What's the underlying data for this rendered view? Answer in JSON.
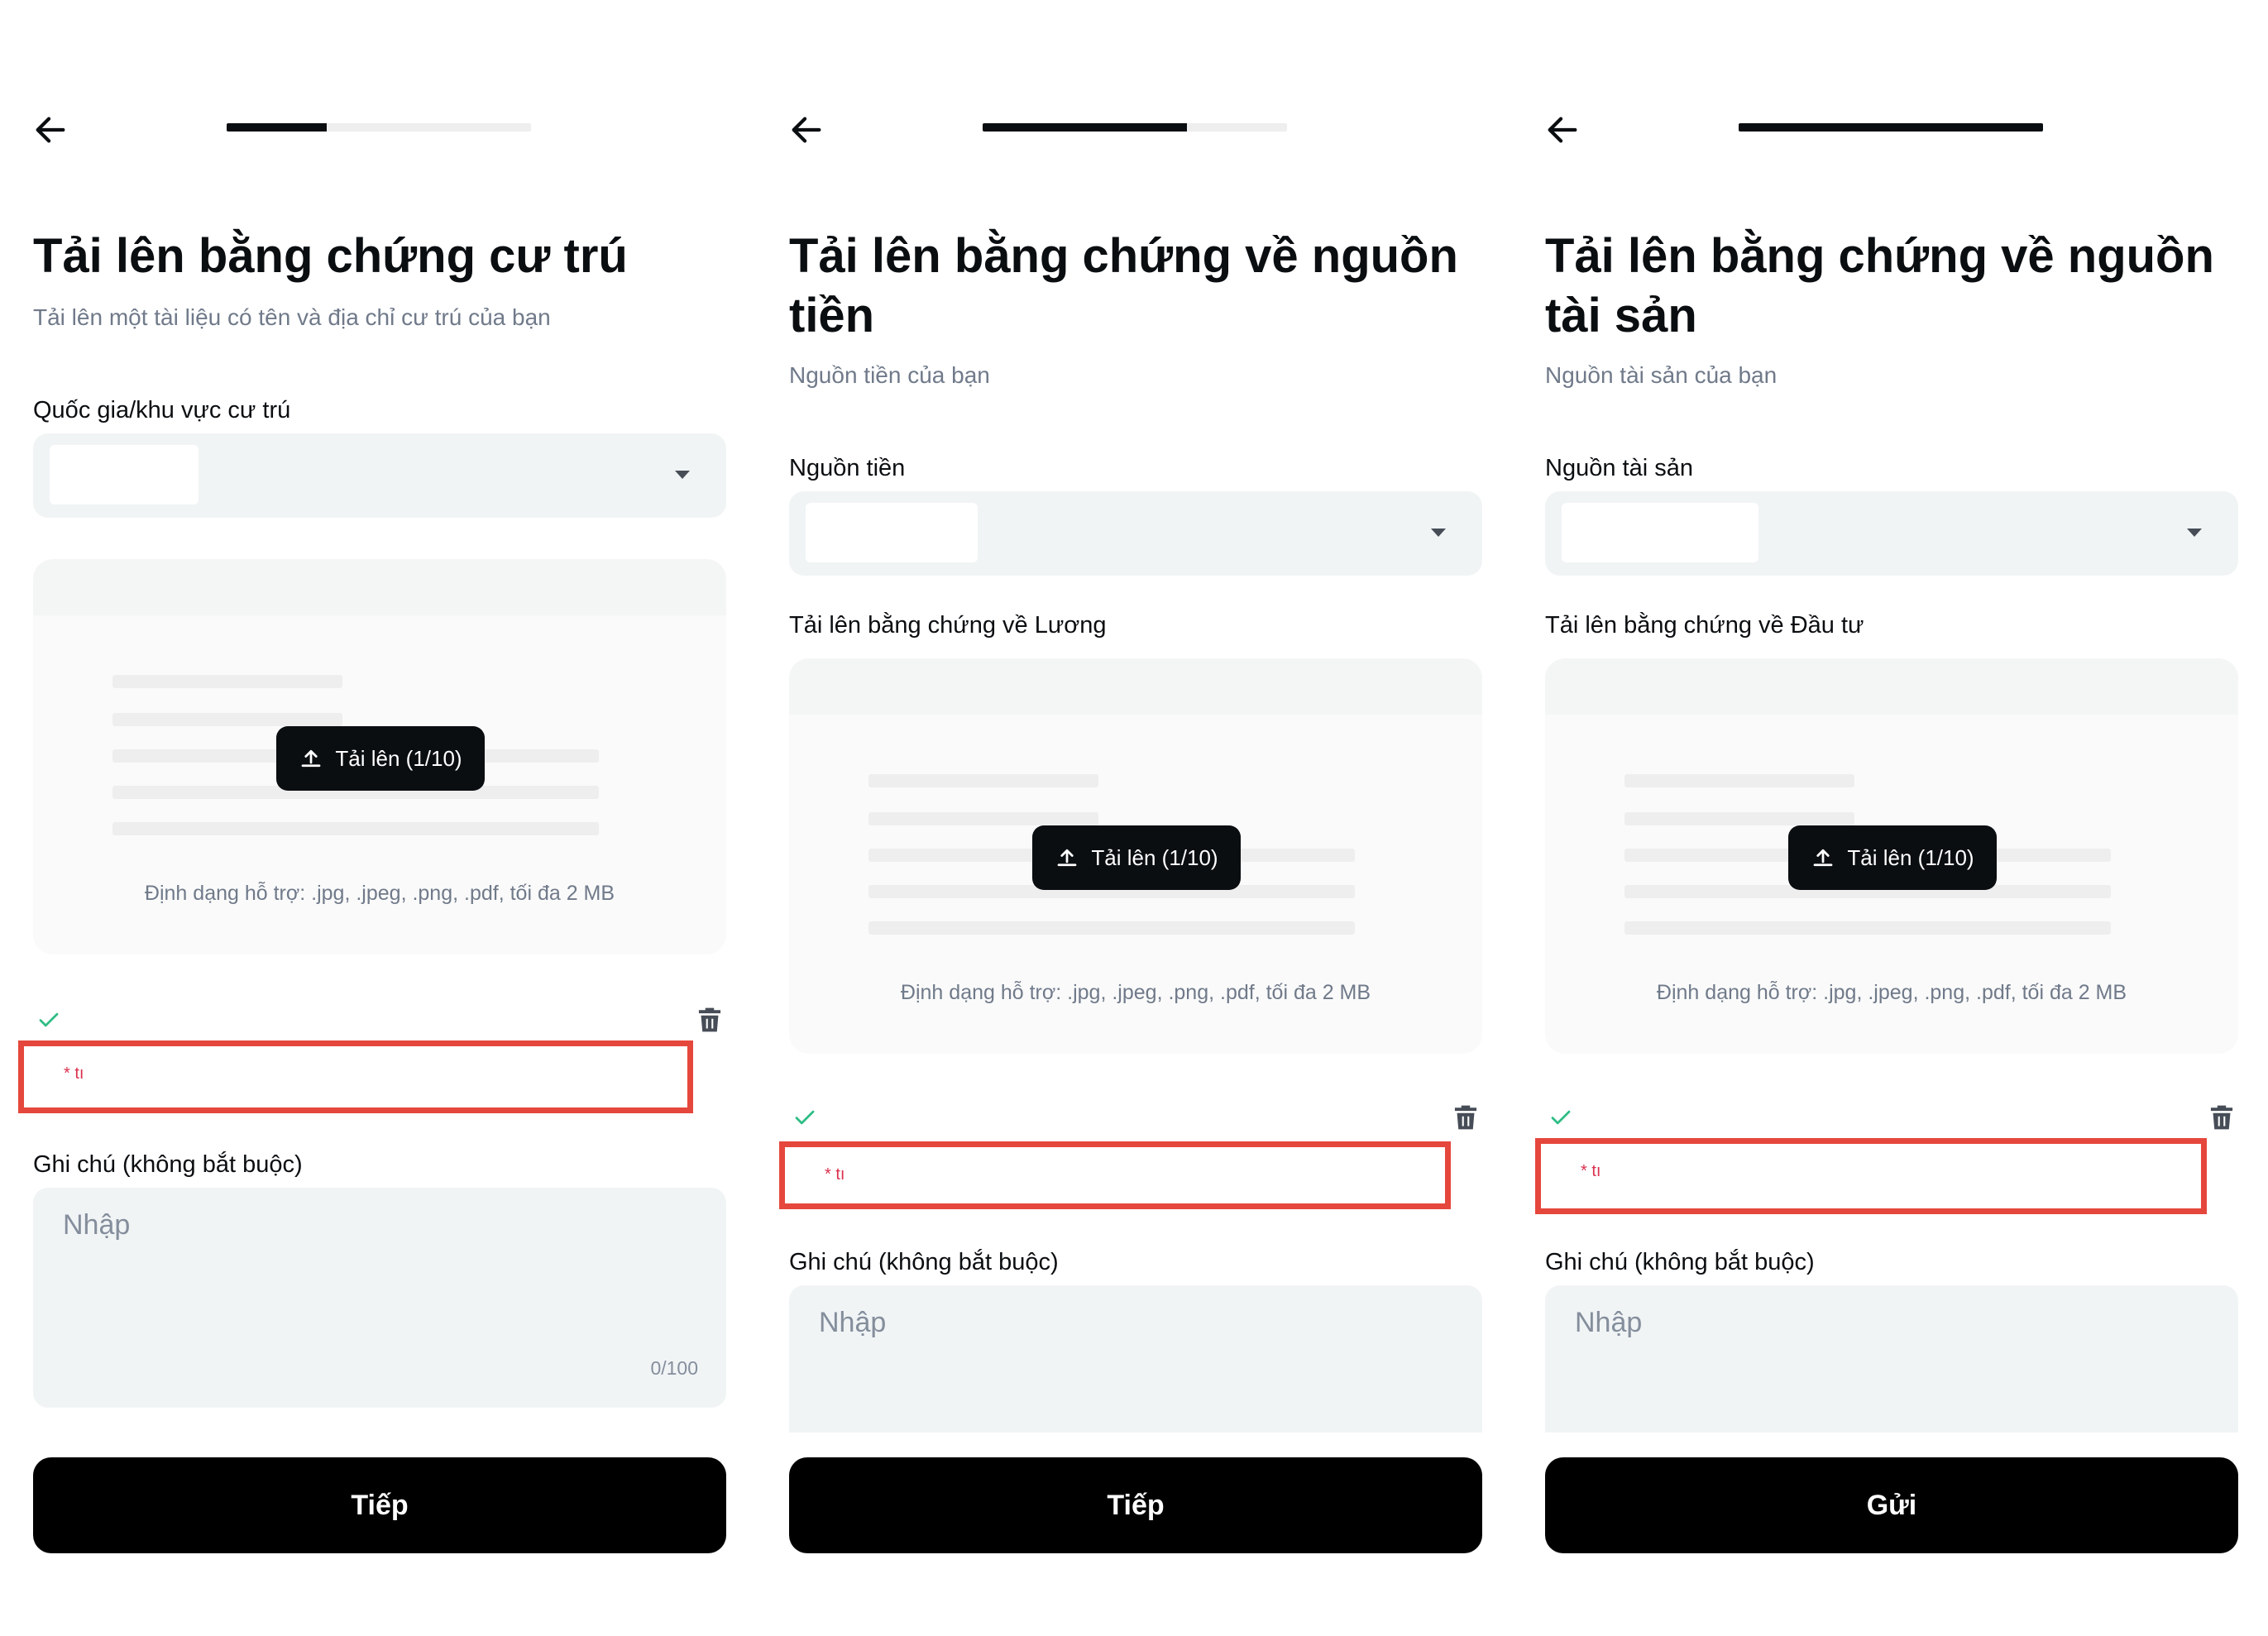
{
  "icons": {
    "back": "arrow-left-icon",
    "upload": "upload-icon",
    "check": "check-icon",
    "trash": "trash-icon",
    "caret": "caret-down-icon"
  },
  "colors": {
    "primary": "#0b0e11",
    "field_bg": "#f1f4f5",
    "highlight_border": "#e5473c",
    "check": "#2ebd85",
    "muted_text": "#707a8a"
  },
  "panels": [
    {
      "progress": 0.33,
      "title": "Tải lên bằng chứng cư trú",
      "subtitle": "Tải lên một tài liệu có tên và địa chỉ cư trú của bạn",
      "select_label": "Quốc gia/khu vực cư trú",
      "select_value": "",
      "upload_section_label": "",
      "upload_button_label": "Tải lên (1/10)",
      "format_hint": "Định dạng hỗ trợ: .jpg, .jpeg, .png, .pdf, tối đa 2 MB",
      "file_name": "* tı",
      "notes_label": "Ghi chú (không bắt buộc)",
      "notes_placeholder": "Nhập",
      "notes_counter": "0/100",
      "primary_button_label": "Tiếp"
    },
    {
      "progress": 0.67,
      "title": "Tải lên bằng chứng về nguồn tiền",
      "subtitle": "Nguồn tiền của bạn",
      "select_label": "Nguồn tiền",
      "select_value": "",
      "upload_section_label": "Tải lên bằng chứng về Lương",
      "upload_button_label": "Tải lên (1/10)",
      "format_hint": "Định dạng hỗ trợ: .jpg, .jpeg, .png, .pdf, tối đa 2 MB",
      "file_name": "* tı",
      "notes_label": "Ghi chú (không bắt buộc)",
      "notes_placeholder": "Nhập",
      "notes_counter": "",
      "primary_button_label": "Tiếp"
    },
    {
      "progress": 1.0,
      "title": "Tải lên bằng chứng về nguồn tài sản",
      "subtitle": "Nguồn tài sản của bạn",
      "select_label": "Nguồn tài sản",
      "select_value": "",
      "upload_section_label": "Tải lên bằng chứng về Đầu tư",
      "upload_button_label": "Tải lên (1/10)",
      "format_hint": "Định dạng hỗ trợ: .jpg, .jpeg, .png, .pdf, tối đa 2 MB",
      "file_name": "* tı",
      "notes_label": "Ghi chú (không bắt buộc)",
      "notes_placeholder": "Nhập",
      "notes_counter": "",
      "primary_button_label": "Gửi"
    }
  ]
}
